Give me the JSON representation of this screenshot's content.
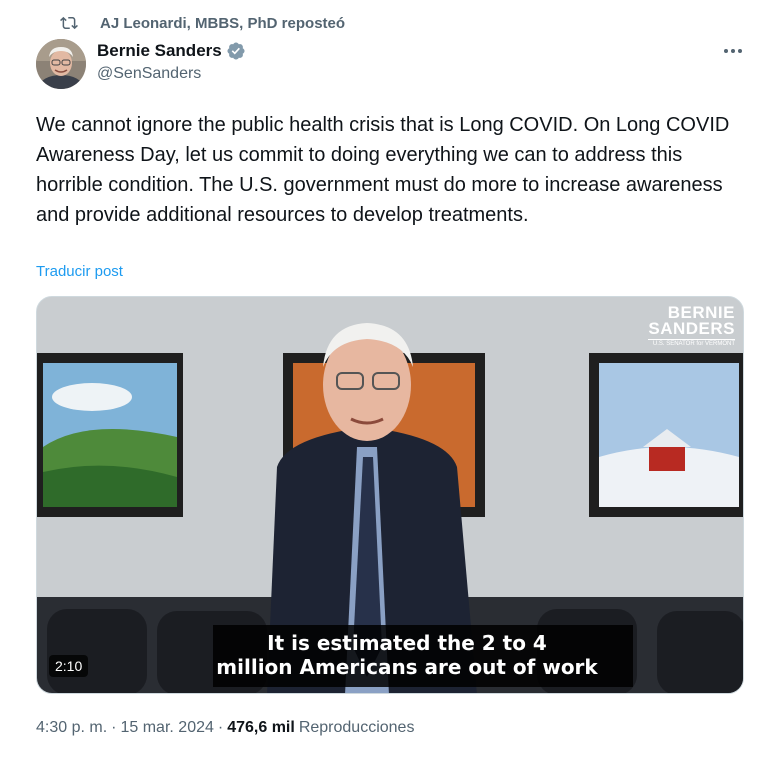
{
  "repost": {
    "text": "AJ Leonardi, MBBS, PhD reposteó",
    "icon": "repost-icon"
  },
  "author": {
    "name": "Bernie Sanders",
    "handle": "@SenSanders",
    "verified": true,
    "verified_color": "#829aab"
  },
  "tweet": {
    "text": "We cannot ignore the public health crisis that is Long COVID. On Long COVID Awareness Day, let us commit to doing everything we can to address this horrible condition. The U.S. government must do more to increase awareness and provide additional resources to develop treatments.",
    "translate_label": "Traducir post"
  },
  "video": {
    "duration": "2:10",
    "caption_line1": "It is estimated the 2 to 4",
    "caption_line2": "million Americans are out of work",
    "watermark_line1": "BERNIE",
    "watermark_line2": "SANDERS",
    "watermark_line3": "U.S. SENATOR for VERMONT"
  },
  "meta": {
    "time": "4:30 p. m.",
    "separator": "·",
    "date": "15 mar. 2024",
    "views_count": "476,6 mil",
    "views_label": "Reproducciones"
  },
  "colors": {
    "text_primary": "#0f1419",
    "text_secondary": "#536471",
    "link": "#1d9bf0"
  }
}
